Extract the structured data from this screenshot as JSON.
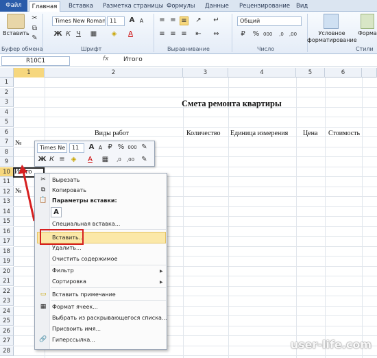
{
  "ribbon": {
    "tabs": [
      "Файл",
      "Главная",
      "Вставка",
      "Разметка страницы",
      "Формулы",
      "Данные",
      "Рецензирование",
      "Вид"
    ],
    "paste_label": "Вставить",
    "font_name": "Times New Roman",
    "font_size": "11",
    "number_format": "Общий",
    "conditional_format_label": "Условное форматирование",
    "format_table_label": "Формат как т",
    "groups": [
      "Буфер обмена",
      "Шрифт",
      "Выравнивание",
      "Число",
      "Стили"
    ]
  },
  "formula_bar": {
    "name_box": "R10C1",
    "fx": "fx",
    "value": "Итого"
  },
  "grid": {
    "columns": [
      "1",
      "2",
      "3",
      "4",
      "5",
      "6"
    ],
    "rows": [
      "1",
      "2",
      "3",
      "4",
      "5",
      "6",
      "7",
      "8",
      "9",
      "10",
      "11",
      "12",
      "13",
      "14",
      "15",
      "16",
      "17",
      "18",
      "19",
      "20",
      "21",
      "22",
      "23",
      "24",
      "25",
      "26",
      "27",
      "28"
    ],
    "title": "Смета ремонта квартиры",
    "headers": [
      "Виды работ",
      "Количество",
      "Единица измерения",
      "Цена",
      "Стоимость"
    ],
    "cell_no_1": "№",
    "cell_no_2": "№",
    "cell_total": "Итого"
  },
  "mini_toolbar": {
    "font": "Times Ne",
    "size": "11",
    "percent": "%",
    "thousands": "000"
  },
  "context_menu": {
    "items": [
      "Вырезать",
      "Копировать",
      "Параметры вставки:",
      "Специальная вставка...",
      "Вставить...",
      "Удалить...",
      "Очистить содержимое",
      "Фильтр",
      "Сортировка",
      "Вставить примечание",
      "Формат ячеек...",
      "Выбрать из раскрывающегося списка...",
      "Присвоить имя...",
      "Гиперссылка..."
    ],
    "paste_option": "A"
  },
  "watermark": "user-life.com",
  "colors": {
    "accent": "#2a5caa",
    "highlight": "#fbe8a8",
    "annotation": "#d62020"
  }
}
